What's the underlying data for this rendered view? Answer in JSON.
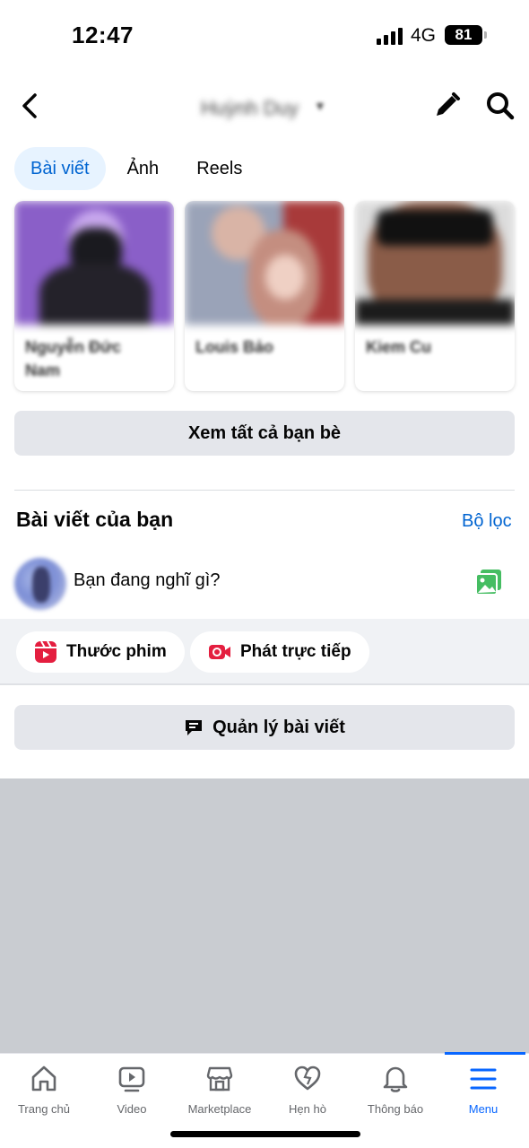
{
  "status_bar": {
    "time": "12:47",
    "network": "4G",
    "battery": "81"
  },
  "header": {
    "profile_name": "Huỳnh Duy",
    "back_icon": "chevron-left-icon",
    "edit_icon": "pencil-icon",
    "search_icon": "search-icon"
  },
  "tabs": [
    {
      "label": "Bài viết",
      "active": true
    },
    {
      "label": "Ảnh",
      "active": false
    },
    {
      "label": "Reels",
      "active": false
    }
  ],
  "friends": [
    {
      "name": "Nguyễn Đức Nam"
    },
    {
      "name": "Louis Bảo"
    },
    {
      "name": "Kiem Cu"
    }
  ],
  "see_all_friends_label": "Xem tất cả bạn bè",
  "posts_section": {
    "title": "Bài viết của bạn",
    "filter_label": "Bộ lọc"
  },
  "composer": {
    "prompt": "Bạn đang nghĩ gì?",
    "photo_icon": "photo-icon"
  },
  "chips": [
    {
      "label": "Thước phim",
      "icon": "reels-icon",
      "color": "#e41e3f"
    },
    {
      "label": "Phát trực tiếp",
      "icon": "live-video-icon",
      "color": "#e41e3f"
    }
  ],
  "manage_posts_label": "Quản lý bài viết",
  "bottom_nav": [
    {
      "label": "Trang chủ",
      "icon": "home-icon",
      "active": false
    },
    {
      "label": "Video",
      "icon": "video-icon",
      "active": false
    },
    {
      "label": "Marketplace",
      "icon": "marketplace-icon",
      "active": false
    },
    {
      "label": "Hẹn hò",
      "icon": "dating-heart-icon",
      "active": false
    },
    {
      "label": "Thông báo",
      "icon": "bell-icon",
      "active": false
    },
    {
      "label": "Menu",
      "icon": "menu-icon",
      "active": true
    }
  ],
  "colors": {
    "accent": "#0866ff",
    "tab_active_bg": "#e7f3ff",
    "tab_active_text": "#0064d1",
    "button_bg": "#e4e6eb",
    "icon_red": "#e41e3f",
    "icon_green": "#45bd62"
  }
}
